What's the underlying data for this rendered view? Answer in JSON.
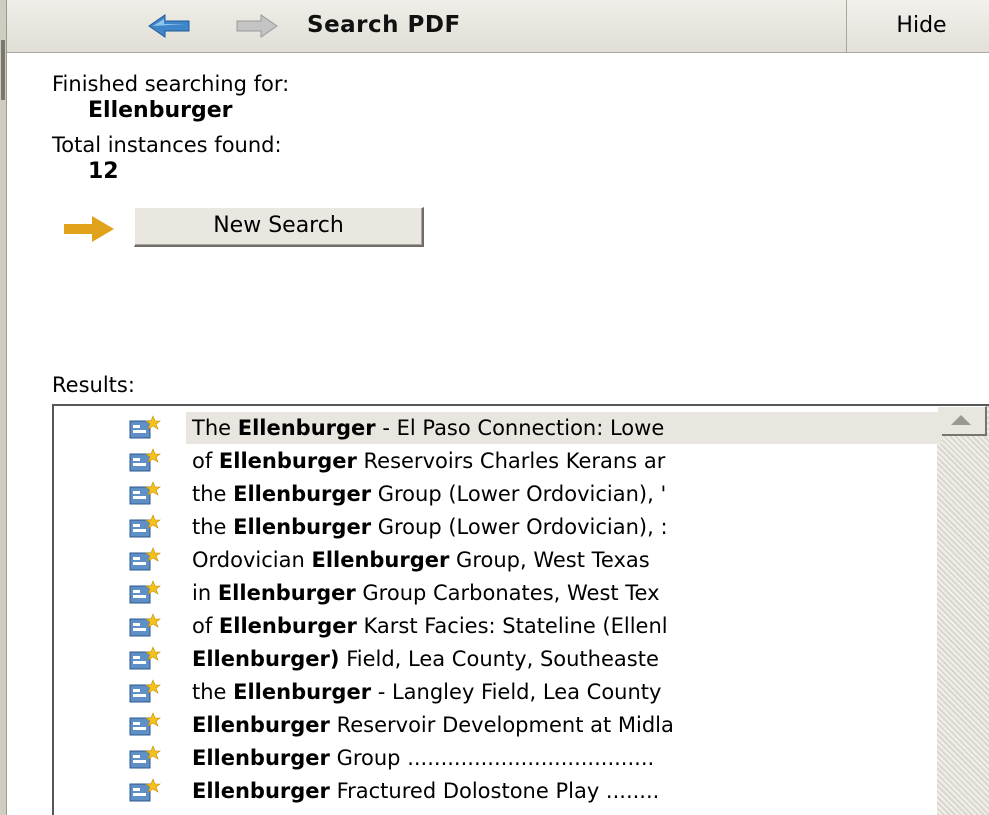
{
  "toolbar": {
    "title": "Search PDF",
    "hide_label": "Hide",
    "back_icon": "arrow-left-icon",
    "forward_icon": "arrow-right-icon"
  },
  "status": {
    "finished_label": "Finished searching for:",
    "search_term": "Ellenburger",
    "total_label": "Total instances found:",
    "total_count": "12"
  },
  "new_search_label": "New Search",
  "results_label": "Results:",
  "results": [
    {
      "pre": "The ",
      "term": "Ellenburger",
      "post": " - El Paso Connection: Lowe"
    },
    {
      "pre": "of ",
      "term": "Ellenburger",
      "post": " Reservoirs Charles Kerans ar"
    },
    {
      "pre": "the ",
      "term": "Ellenburger",
      "post": " Group (Lower Ordovician), '"
    },
    {
      "pre": "the ",
      "term": "Ellenburger",
      "post": " Group (Lower Ordovician), :"
    },
    {
      "pre": "Ordovician ",
      "term": "Ellenburger",
      "post": " Group, West Texas"
    },
    {
      "pre": "in ",
      "term": "Ellenburger",
      "post": " Group Carbonates, West Tex"
    },
    {
      "pre": "of ",
      "term": "Ellenburger",
      "post": " Karst Facies: Stateline (Ellenl"
    },
    {
      "pre": "",
      "term": "Ellenburger)",
      "post": " Field, Lea County, Southeaste"
    },
    {
      "pre": "the ",
      "term": "Ellenburger",
      "post": " - Langley Field, Lea County"
    },
    {
      "pre": "",
      "term": "Ellenburger",
      "post": " Reservoir Development at Midla"
    },
    {
      "pre": "",
      "term": "Ellenburger",
      "post": " Group ....................................."
    },
    {
      "pre": "",
      "term": "Ellenburger",
      "post": " Fractured Dolostone Play ........"
    }
  ],
  "colors": {
    "back_arrow": "#3f86c8",
    "forward_arrow": "#b9b9b9",
    "pointer_arrow": "#e0a21b"
  }
}
